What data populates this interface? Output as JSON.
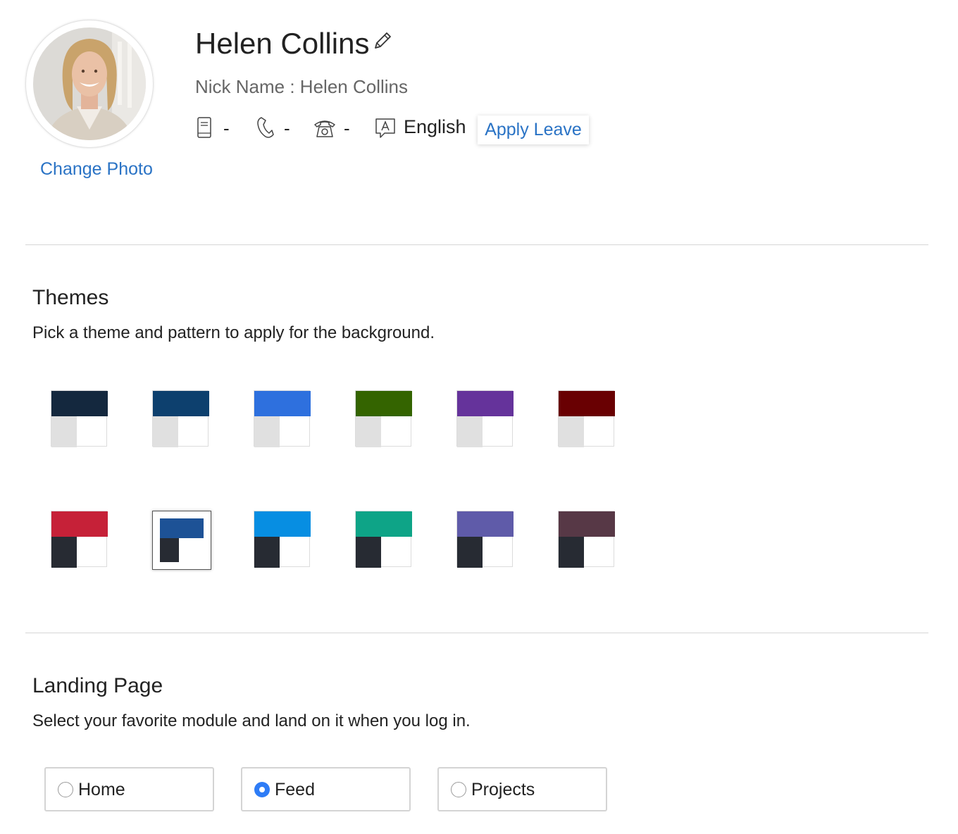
{
  "profile": {
    "name": "Helen Collins",
    "nickname_line": "Nick Name : Helen Collins",
    "change_photo_label": "Change Photo",
    "mobile_value": "-",
    "phone_value": "-",
    "work_phone_value": "-",
    "language": "English",
    "apply_leave_label": "Apply Leave"
  },
  "themes": {
    "title": "Themes",
    "description": "Pick a theme and pattern to apply for the background.",
    "selected_index": 7,
    "items": [
      {
        "top": "#14283e",
        "side": "#e0e0e0"
      },
      {
        "top": "#0d406e",
        "side": "#e0e0e0"
      },
      {
        "top": "#2e70de",
        "side": "#e0e0e0"
      },
      {
        "top": "#346400",
        "side": "#e0e0e0"
      },
      {
        "top": "#65339b",
        "side": "#e0e0e0"
      },
      {
        "top": "#690002",
        "side": "#e0e0e0"
      },
      {
        "top": "#c62138",
        "side": "#272b33"
      },
      {
        "top": "#1d5296",
        "side": "#272b33"
      },
      {
        "top": "#078ee2",
        "side": "#272b33"
      },
      {
        "top": "#0ea487",
        "side": "#272b33"
      },
      {
        "top": "#5f5ba9",
        "side": "#272b33"
      },
      {
        "top": "#573846",
        "side": "#272b33"
      }
    ]
  },
  "landing": {
    "title": "Landing Page",
    "description": "Select your favorite module and land on it when you log in.",
    "options": [
      {
        "label": "Home",
        "selected": false
      },
      {
        "label": "Feed",
        "selected": true
      },
      {
        "label": "Projects",
        "selected": false
      }
    ]
  },
  "colors": {
    "link": "#2a73c5",
    "radio_selected": "#2e7cf6"
  }
}
